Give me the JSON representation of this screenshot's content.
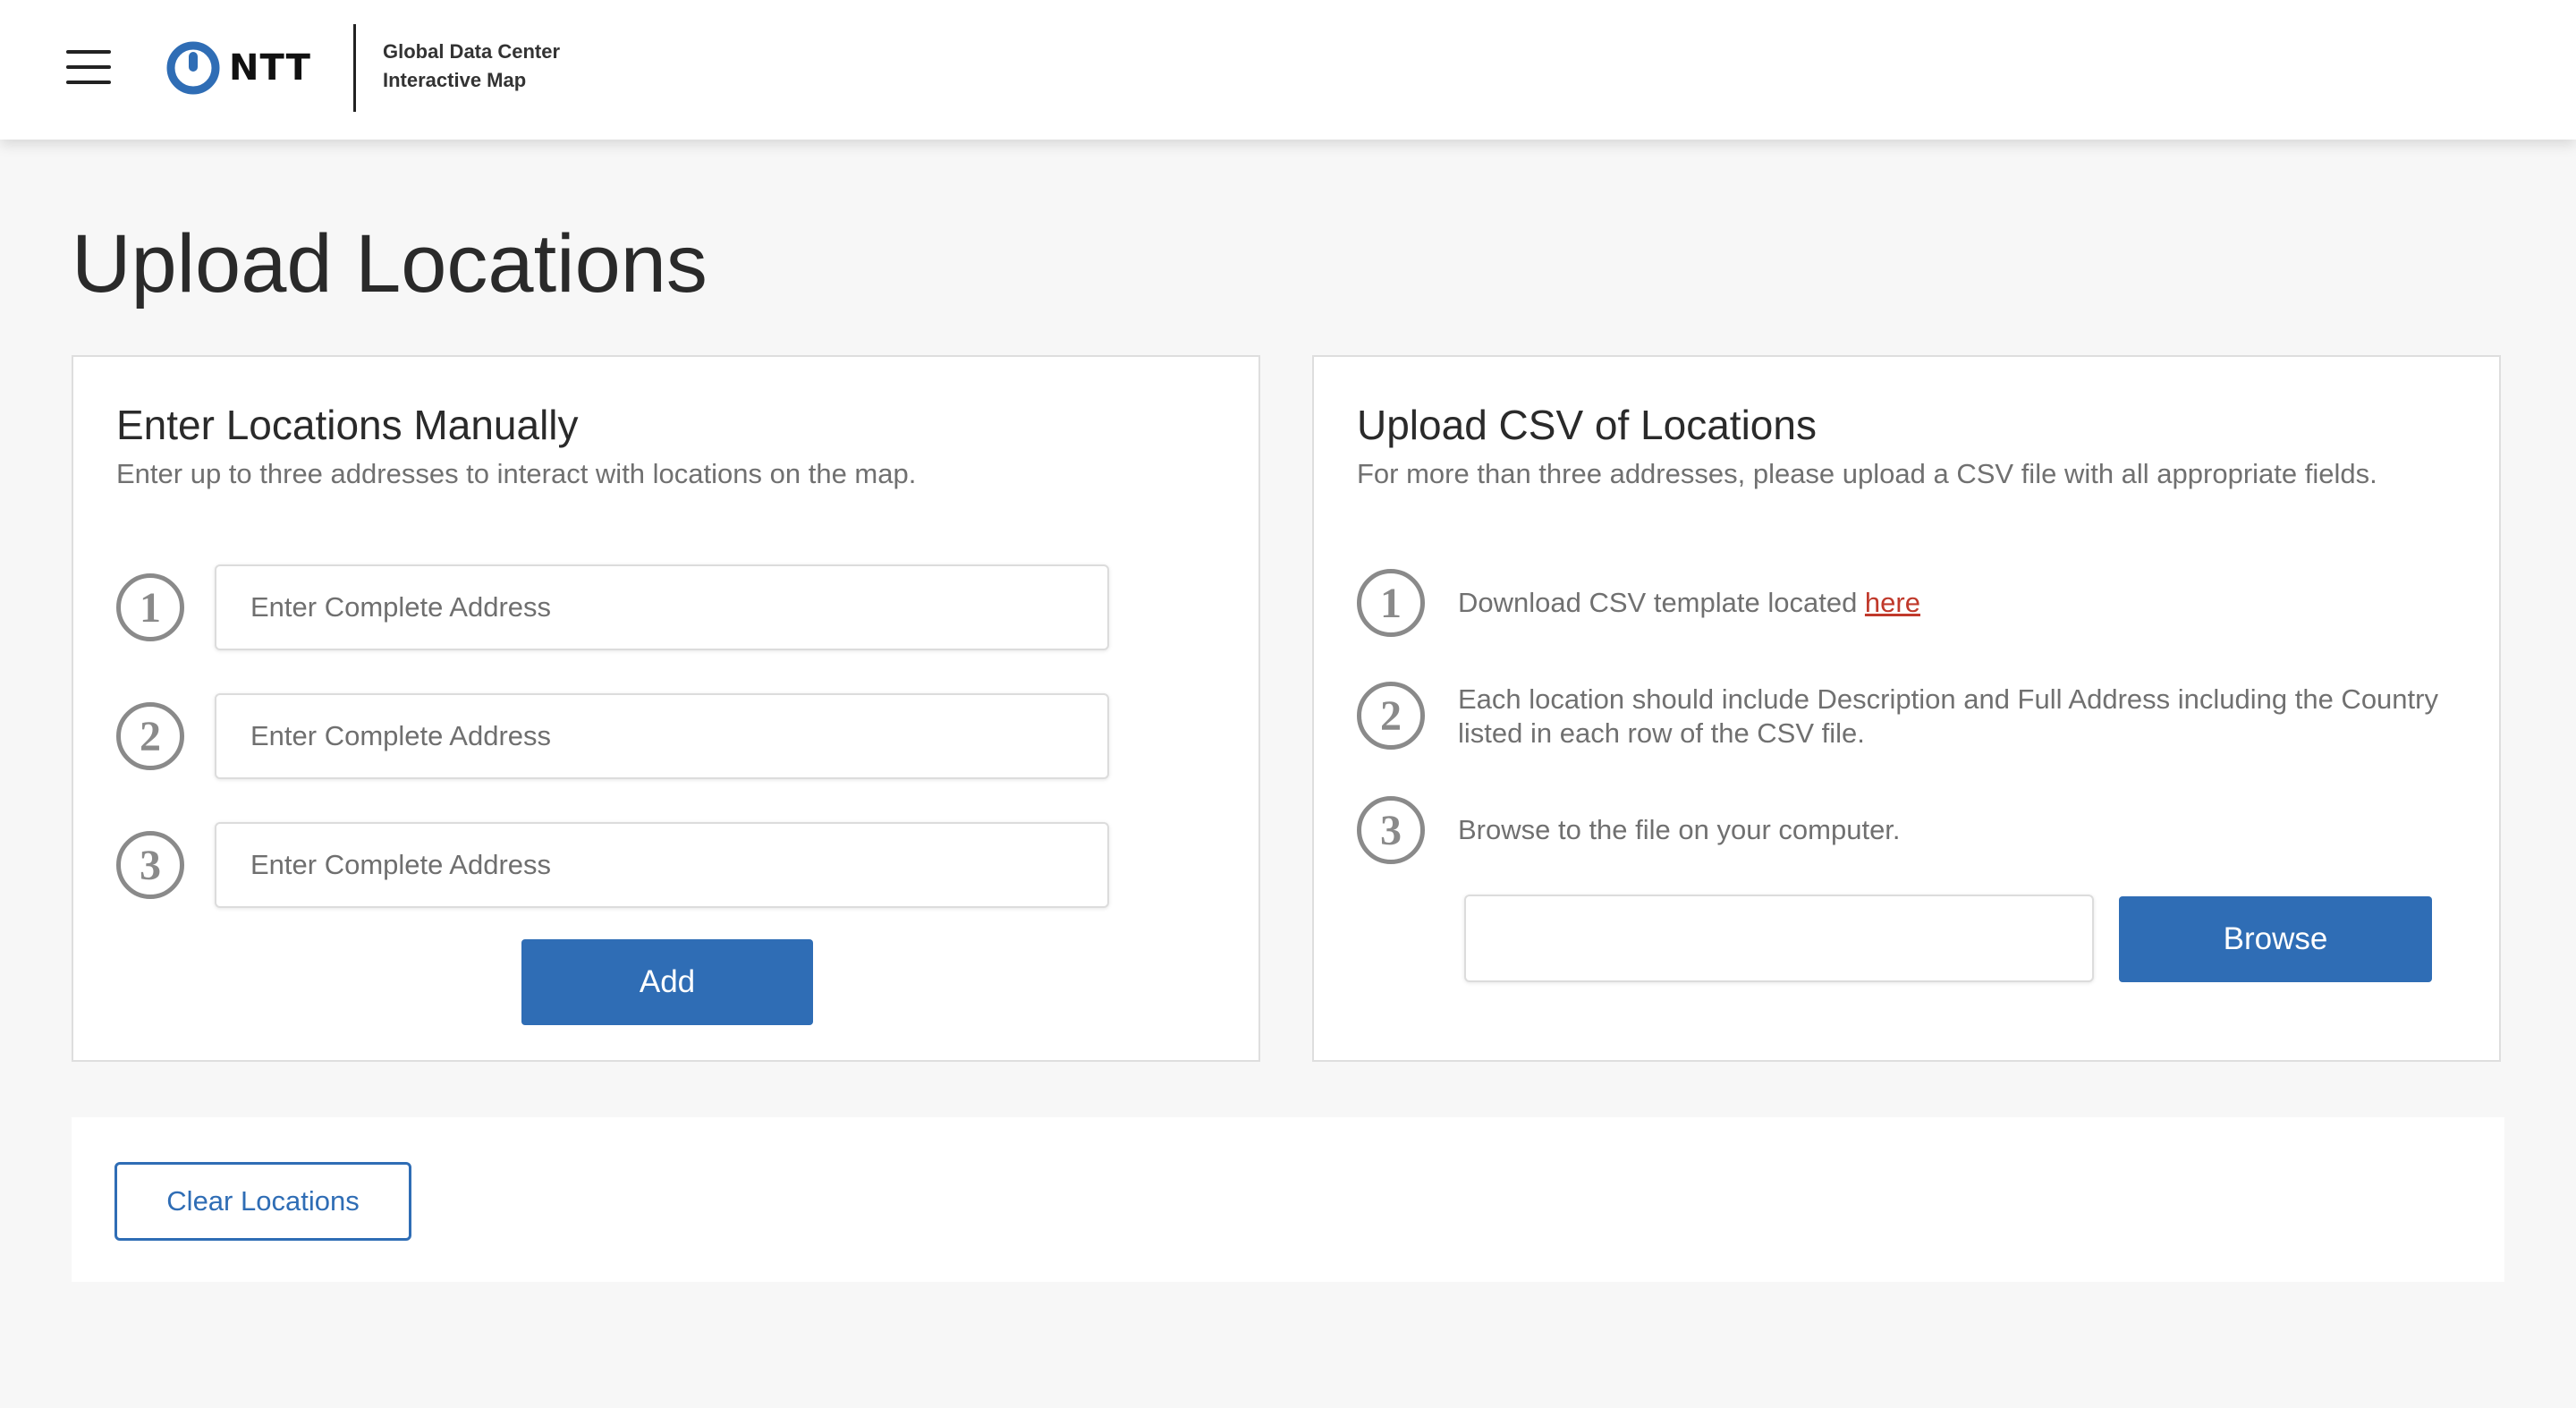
{
  "header": {
    "menu_icon": "hamburger-menu-icon",
    "logo_icon": "ntt-logo-icon",
    "logo_text": "NTT",
    "title_line1": "Global Data Center",
    "title_line2": "Interactive Map",
    "brand_color": "#2f6db5"
  },
  "page": {
    "title": "Upload Locations"
  },
  "manual": {
    "title": "Enter Locations Manually",
    "subtitle": "Enter up to three addresses to interact with locations on the map.",
    "steps": [
      {
        "number": "1",
        "placeholder": "Enter Complete Address",
        "value": ""
      },
      {
        "number": "2",
        "placeholder": "Enter Complete Address",
        "value": ""
      },
      {
        "number": "3",
        "placeholder": "Enter Complete Address",
        "value": ""
      }
    ],
    "add_label": "Add"
  },
  "csv": {
    "title": "Upload CSV of Locations",
    "subtitle": "For more than three addresses, please upload a CSV file with all appropriate fields.",
    "steps": [
      {
        "number": "1",
        "text": "Download CSV template located ",
        "link": "here"
      },
      {
        "number": "2",
        "text": "Each location should include Description and Full Address including the Country listed in each row of the CSV file."
      },
      {
        "number": "3",
        "text": "Browse to the file on your computer."
      }
    ],
    "file_value": "",
    "browse_label": "Browse"
  },
  "actions": {
    "clear_label": "Clear Locations"
  },
  "colors": {
    "accent": "#2f6db5",
    "link": "#c0392b",
    "page_background": "#f7f7f7"
  }
}
